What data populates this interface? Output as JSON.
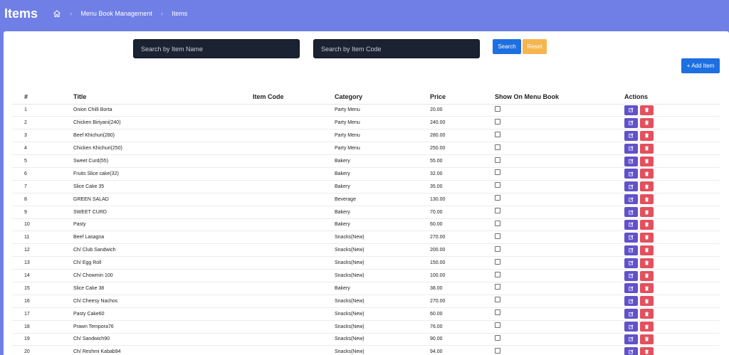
{
  "header": {
    "title": "Items",
    "breadcrumbs": [
      "Menu Book Management",
      "Items"
    ]
  },
  "search": {
    "name_placeholder": "Search by Item Name",
    "code_placeholder": "Search by Item Code",
    "search_label": "Search",
    "reset_label": "Reset"
  },
  "toolbar": {
    "add_label": "+ Add Item"
  },
  "table": {
    "columns": [
      "#",
      "Title",
      "Item Code",
      "Category",
      "Price",
      "Show On Menu Book",
      "Actions"
    ],
    "rows": [
      {
        "num": "1",
        "title": "Onion Chilli Borta",
        "code": "",
        "category": "Party Menu",
        "price": "20.00",
        "show": false
      },
      {
        "num": "2",
        "title": "Chicken Biriyani(240)",
        "code": "",
        "category": "Party Menu",
        "price": "240.00",
        "show": false
      },
      {
        "num": "3",
        "title": "Beef Khichuri(280)",
        "code": "",
        "category": "Party Menu",
        "price": "280.00",
        "show": false
      },
      {
        "num": "4",
        "title": "Chicken Khichuri(250)",
        "code": "",
        "category": "Party Menu",
        "price": "250.00",
        "show": false
      },
      {
        "num": "5",
        "title": "Sweet Curd(55)",
        "code": "",
        "category": "Bakery",
        "price": "55.00",
        "show": false
      },
      {
        "num": "6",
        "title": "Fruits Slice cake(32)",
        "code": "",
        "category": "Bakery",
        "price": "32.00",
        "show": false
      },
      {
        "num": "7",
        "title": "Slice Cake 35",
        "code": "",
        "category": "Bakery",
        "price": "35.00",
        "show": false
      },
      {
        "num": "8",
        "title": "GREEN SALAD",
        "code": "",
        "category": "Beverage",
        "price": "130.00",
        "show": false
      },
      {
        "num": "9",
        "title": "SWEET CURD",
        "code": "",
        "category": "Bakery",
        "price": "70.00",
        "show": false
      },
      {
        "num": "10",
        "title": "Pasty",
        "code": "",
        "category": "Bakery",
        "price": "60.00",
        "show": false
      },
      {
        "num": "11",
        "title": "Beef Lasagna",
        "code": "",
        "category": "Snacks(New)",
        "price": "270.00",
        "show": false
      },
      {
        "num": "12",
        "title": "Ch/ Club Sandwich",
        "code": "",
        "category": "Snacks(New)",
        "price": "200.00",
        "show": false
      },
      {
        "num": "13",
        "title": "Ch/ Egg Roll",
        "code": "",
        "category": "Snacks(New)",
        "price": "150.00",
        "show": false
      },
      {
        "num": "14",
        "title": "Ch/ Chowmin 100",
        "code": "",
        "category": "Snacks(New)",
        "price": "100.00",
        "show": false
      },
      {
        "num": "15",
        "title": "Slice Cake 38",
        "code": "",
        "category": "Bakery",
        "price": "38.00",
        "show": false
      },
      {
        "num": "16",
        "title": "Ch/ Cheesy Nachos",
        "code": "",
        "category": "Snacks(New)",
        "price": "270.00",
        "show": false
      },
      {
        "num": "17",
        "title": "Pasty Cake60",
        "code": "",
        "category": "Snacks(New)",
        "price": "60.00",
        "show": false
      },
      {
        "num": "18",
        "title": "Prawn Tempora76",
        "code": "",
        "category": "Snacks(New)",
        "price": "76.00",
        "show": false
      },
      {
        "num": "19",
        "title": "Ch/ Sandwich90",
        "code": "",
        "category": "Snacks(New)",
        "price": "90.00",
        "show": false
      },
      {
        "num": "20",
        "title": "Ch/ Reshmi Kabab94",
        "code": "",
        "category": "Snacks(New)",
        "price": "94.00",
        "show": false
      }
    ]
  },
  "icons": {
    "home": "home-icon",
    "breadcrumb_separator": "chevron-right-icon",
    "edit": "edit-icon",
    "delete": "trash-icon"
  },
  "colors": {
    "header_bg": "#6f7fe6",
    "primary": "#1e6fe0",
    "warning": "#f6b54f",
    "edit": "#6152c9",
    "delete": "#e4505d",
    "search_bg": "#1b2232"
  }
}
